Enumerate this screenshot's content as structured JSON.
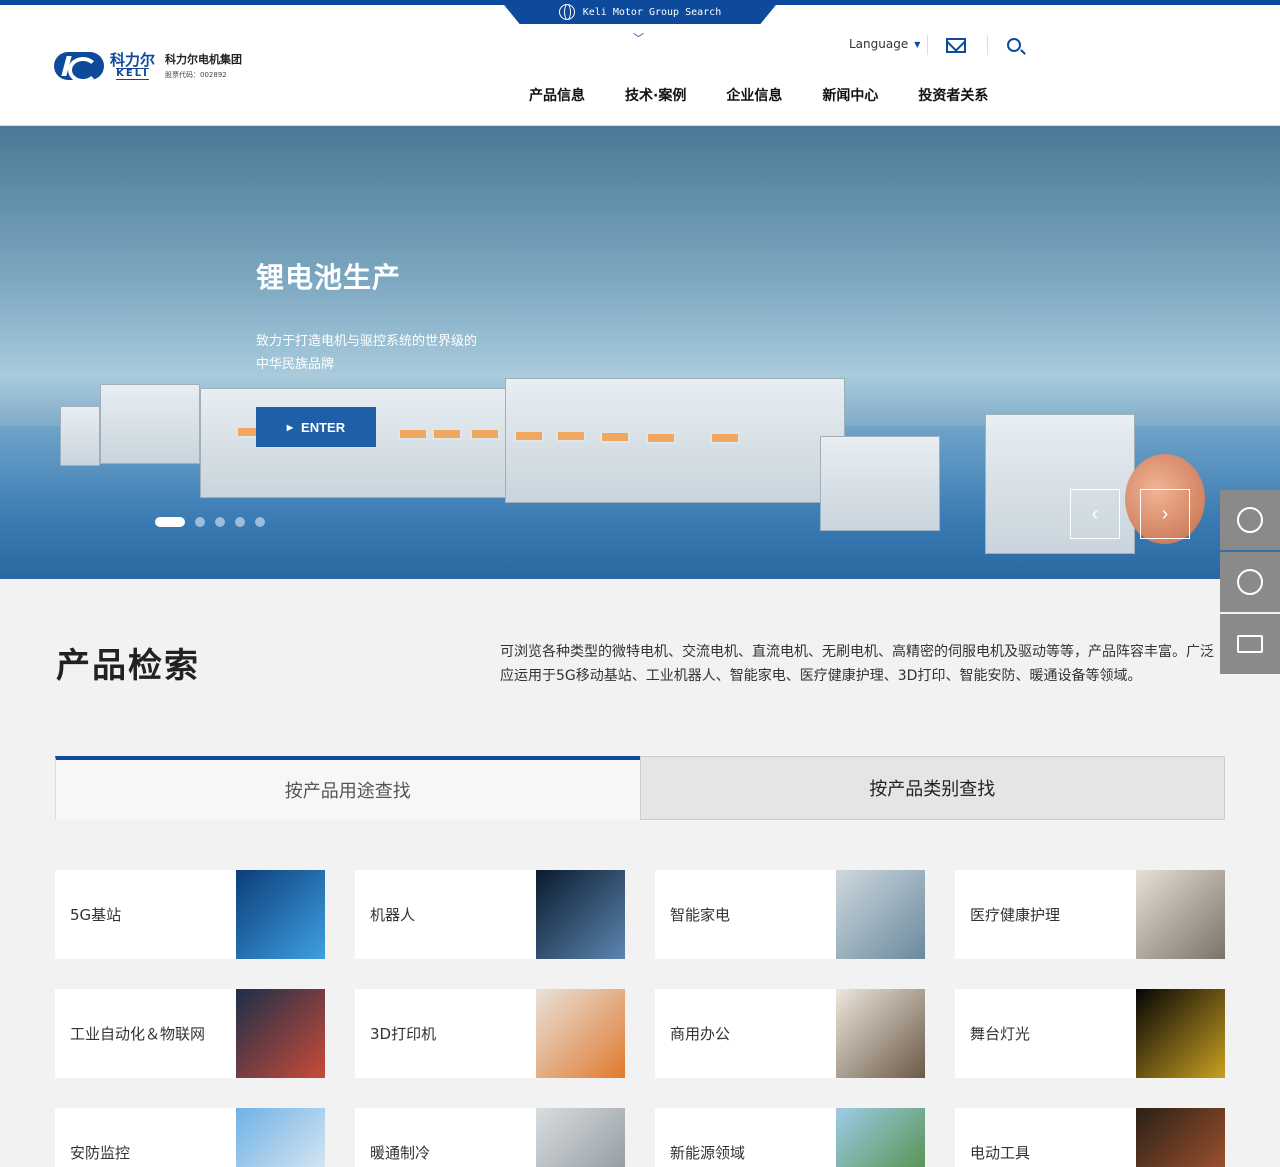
{
  "top": {
    "search_tab": "Keli Motor Group Search"
  },
  "logo": {
    "cn": "科力尔",
    "en": "KELI",
    "name": "科力尔电机集团",
    "code": "股票代码：002892"
  },
  "header": {
    "language": "Language"
  },
  "nav": [
    "产品信息",
    "技术·案例",
    "企业信息",
    "新闻中心",
    "投资者关系"
  ],
  "hero": {
    "title": "锂电池生产",
    "subtitle": "致力于打造电机与驱控系统的世界级的中华民族品牌",
    "enter_label": "ENTER",
    "slides": 5,
    "active_slide": 1
  },
  "section": {
    "title": "产品检索",
    "description": "可浏览各种类型的微特电机、交流电机、直流电机、无刷电机、高精密的伺服电机及驱动等等，产品阵容丰富。广泛应运用于5G移动基站、工业机器人、智能家电、医疗健康护理、3D打印、智能安防、暖通设备等领域。"
  },
  "tabs": [
    "按产品用途查找",
    "按产品类别查找"
  ],
  "categories": [
    {
      "label": "5G基站",
      "colors": [
        "#0b3d7a",
        "#3fa0e0"
      ]
    },
    {
      "label": "机器人",
      "colors": [
        "#0a1a2e",
        "#5c86b0"
      ]
    },
    {
      "label": "智能家电",
      "colors": [
        "#cfd8de",
        "#6a8a9e"
      ]
    },
    {
      "label": "医疗健康护理",
      "colors": [
        "#e6e0d8",
        "#7c7368"
      ]
    },
    {
      "label": "工业自动化＆物联网",
      "colors": [
        "#1c2f4a",
        "#c94a3a"
      ]
    },
    {
      "label": "3D打印机",
      "colors": [
        "#e8e2da",
        "#e07a2e"
      ]
    },
    {
      "label": "商用办公",
      "colors": [
        "#ede6dc",
        "#6b5a48"
      ]
    },
    {
      "label": "舞台灯光",
      "colors": [
        "#050505",
        "#c9a020"
      ]
    },
    {
      "label": "安防监控",
      "colors": [
        "#6fb2e6",
        "#e8eef2"
      ]
    },
    {
      "label": "暖通制冷",
      "colors": [
        "#d8dde0",
        "#8a9298"
      ]
    },
    {
      "label": "新能源领域",
      "colors": [
        "#9fcbe6",
        "#4a8a3a"
      ]
    },
    {
      "label": "电动工具",
      "colors": [
        "#2a2018",
        "#b05a30"
      ]
    }
  ]
}
